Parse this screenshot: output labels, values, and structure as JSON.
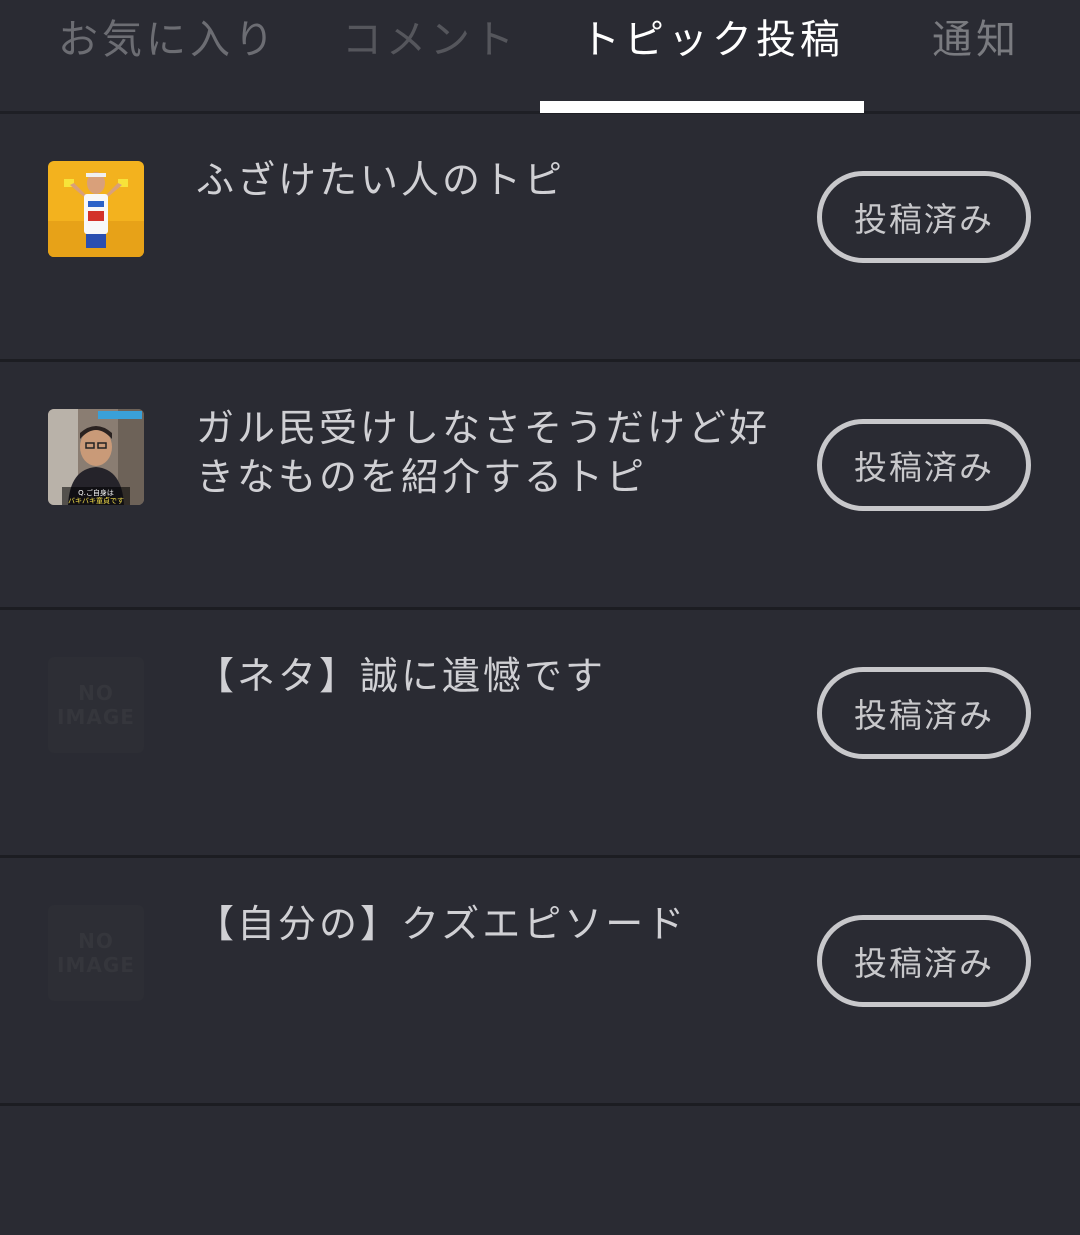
{
  "tabs": {
    "favorites": "お気に入り",
    "comments": "コメント",
    "topic_posts": "トピック投稿",
    "notifications": "通知",
    "active": "topic_posts"
  },
  "topics": [
    {
      "title": "ふざけたい人のトピ",
      "status": "投稿済み",
      "thumbnail": "photo"
    },
    {
      "title": "ガル民受けしなさそうだけど好きなものを紹介するトピ",
      "status": "投稿済み",
      "thumbnail": "photo",
      "thumbnail_caption_1": "Q.ご自身は",
      "thumbnail_caption_2": "バキバキ童貞です"
    },
    {
      "title": "【ネタ】誠に遺憾です",
      "status": "投稿済み",
      "thumbnail": "no-image",
      "noimage_line1": "NO",
      "noimage_line2": "IMAGE"
    },
    {
      "title": "【自分の】クズエピソード",
      "status": "投稿済み",
      "thumbnail": "no-image",
      "noimage_line1": "NO",
      "noimage_line2": "IMAGE"
    }
  ],
  "colors": {
    "background": "#2a2b33",
    "divider": "#1c1d22",
    "active_tab": "#ffffff",
    "inactive_tab": "#6c6d73",
    "button_border": "#c8c8cb"
  }
}
